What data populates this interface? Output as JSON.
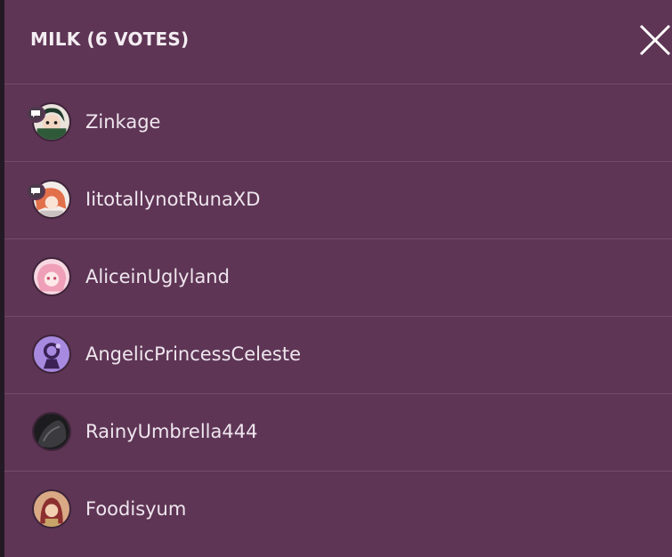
{
  "modal": {
    "title": "MILK (6 VOTES)",
    "close_icon": "close-icon"
  },
  "voters": [
    {
      "username": "Zinkage",
      "has_chat_badge": true
    },
    {
      "username": "IitotallynotRunaXD",
      "has_chat_badge": true
    },
    {
      "username": "AliceinUglyland",
      "has_chat_badge": false
    },
    {
      "username": "AngelicPrincessCeleste",
      "has_chat_badge": false
    },
    {
      "username": "RainyUmbrella444",
      "has_chat_badge": false
    },
    {
      "username": "Foodisyum",
      "has_chat_badge": false
    }
  ],
  "colors": {
    "panel_background": "#5e3555",
    "divider": "rgba(255,255,255,0.12)",
    "text": "#efe6ee"
  }
}
